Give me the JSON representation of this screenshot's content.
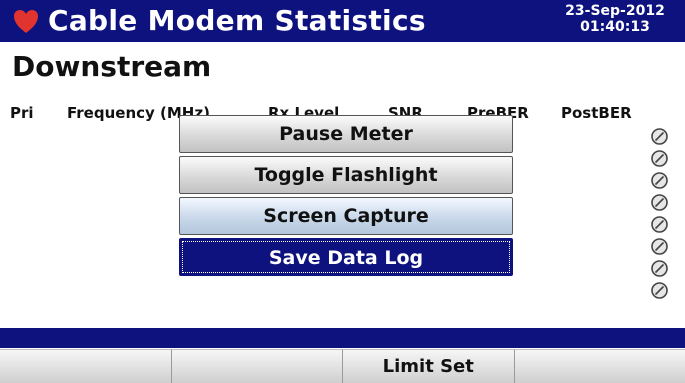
{
  "header": {
    "title": "Cable Modem Statistics",
    "date": "23-Sep-2012",
    "time": "01:40:13",
    "heart_color": "#e2342f",
    "bar_color": "#0d127e"
  },
  "section": {
    "title": "Downstream"
  },
  "columns": [
    "Pri",
    "Frequency (MHz)",
    "Rx Level",
    "SNR",
    "PreBER",
    "PostBER"
  ],
  "status_icons": [
    "no-entry-icon",
    "no-entry-icon",
    "no-entry-icon",
    "no-entry-icon",
    "no-entry-icon",
    "no-entry-icon",
    "no-entry-icon",
    "no-entry-icon"
  ],
  "menu": {
    "items": [
      "Pause Meter",
      "Toggle Flashlight",
      "Screen Capture",
      "Save Data Log"
    ],
    "selected": "Save Data Log"
  },
  "softkeys": [
    "",
    "",
    "Limit Set",
    ""
  ]
}
